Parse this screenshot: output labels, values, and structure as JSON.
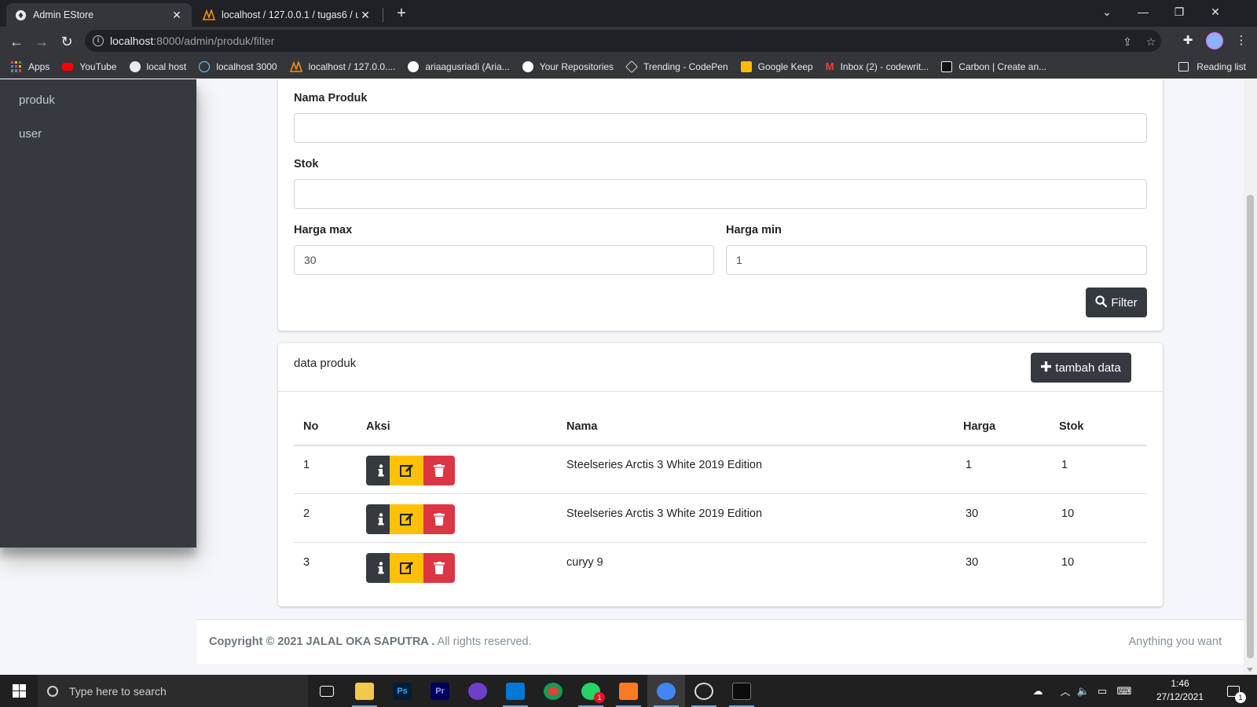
{
  "browser": {
    "tabs": [
      {
        "title": "Admin EStore",
        "active": true
      },
      {
        "title": "localhost / 127.0.0.1 / tugas6 / us",
        "active": false
      }
    ],
    "url_host": "localhost",
    "url_path": ":8000/admin/produk/filter",
    "bookmarks": [
      {
        "label": "Apps",
        "icon": "apps-grid-icon",
        "color": "#ea4335"
      },
      {
        "label": "YouTube",
        "icon": "youtube-icon",
        "color": "#ff0000"
      },
      {
        "label": "local host",
        "icon": "globe-icon",
        "color": "#e8eaed"
      },
      {
        "label": "localhost 3000",
        "icon": "react-icon",
        "color": "#61dafb"
      },
      {
        "label": "localhost / 127.0.0....",
        "icon": "phpmyadmin-icon",
        "color": "#f29111"
      },
      {
        "label": "ariaagusriadi (Aria...",
        "icon": "github-icon",
        "color": "#ffffff"
      },
      {
        "label": "Your Repositories",
        "icon": "github-icon",
        "color": "#ffffff"
      },
      {
        "label": "Trending - CodePen",
        "icon": "codepen-icon",
        "color": "#ffffff"
      },
      {
        "label": "Google Keep",
        "icon": "keep-icon",
        "color": "#fbbc04"
      },
      {
        "label": "Inbox (2) - codewrit...",
        "icon": "gmail-icon",
        "color": "#ea4335"
      },
      {
        "label": "Carbon | Create an...",
        "icon": "carbon-icon",
        "color": "#f5f5f5"
      }
    ],
    "reading_list": "Reading list"
  },
  "sidebar": {
    "items": [
      {
        "label": "produk"
      },
      {
        "label": "user"
      }
    ]
  },
  "filter": {
    "nama_label": "Nama Produk",
    "nama_value": "",
    "stok_label": "Stok",
    "stok_value": "",
    "harga_max_label": "Harga max",
    "harga_max_value": "30",
    "harga_min_label": "Harga min",
    "harga_min_value": "1",
    "filter_button": "Filter"
  },
  "table_card": {
    "title": "data produk",
    "add_button": "tambah data",
    "columns": [
      "No",
      "Aksi",
      "Nama",
      "Harga",
      "Stok"
    ],
    "rows": [
      {
        "no": "1",
        "nama": "Steelseries Arctis 3 White 2019 Edition",
        "harga": "1",
        "stok": "1"
      },
      {
        "no": "2",
        "nama": "Steelseries Arctis 3 White 2019 Edition",
        "harga": "30",
        "stok": "10"
      },
      {
        "no": "3",
        "nama": "curyy 9",
        "harga": "30",
        "stok": "10"
      }
    ]
  },
  "footer": {
    "copyright_bold": "Copyright © 2021 JALAL OKA SAPUTRA .",
    "copyright_rest": " All rights reserved.",
    "right_text": "Anything you want"
  },
  "taskbar": {
    "search_placeholder": "Type here to search",
    "time": "1:46",
    "date": "27/12/2021",
    "whatsapp_badge": "1",
    "notification_badge": "1"
  },
  "colors": {
    "sidebar_bg": "#343a40",
    "btn_dark": "#343a40",
    "btn_warning": "#ffc107",
    "btn_danger": "#dc3545"
  }
}
